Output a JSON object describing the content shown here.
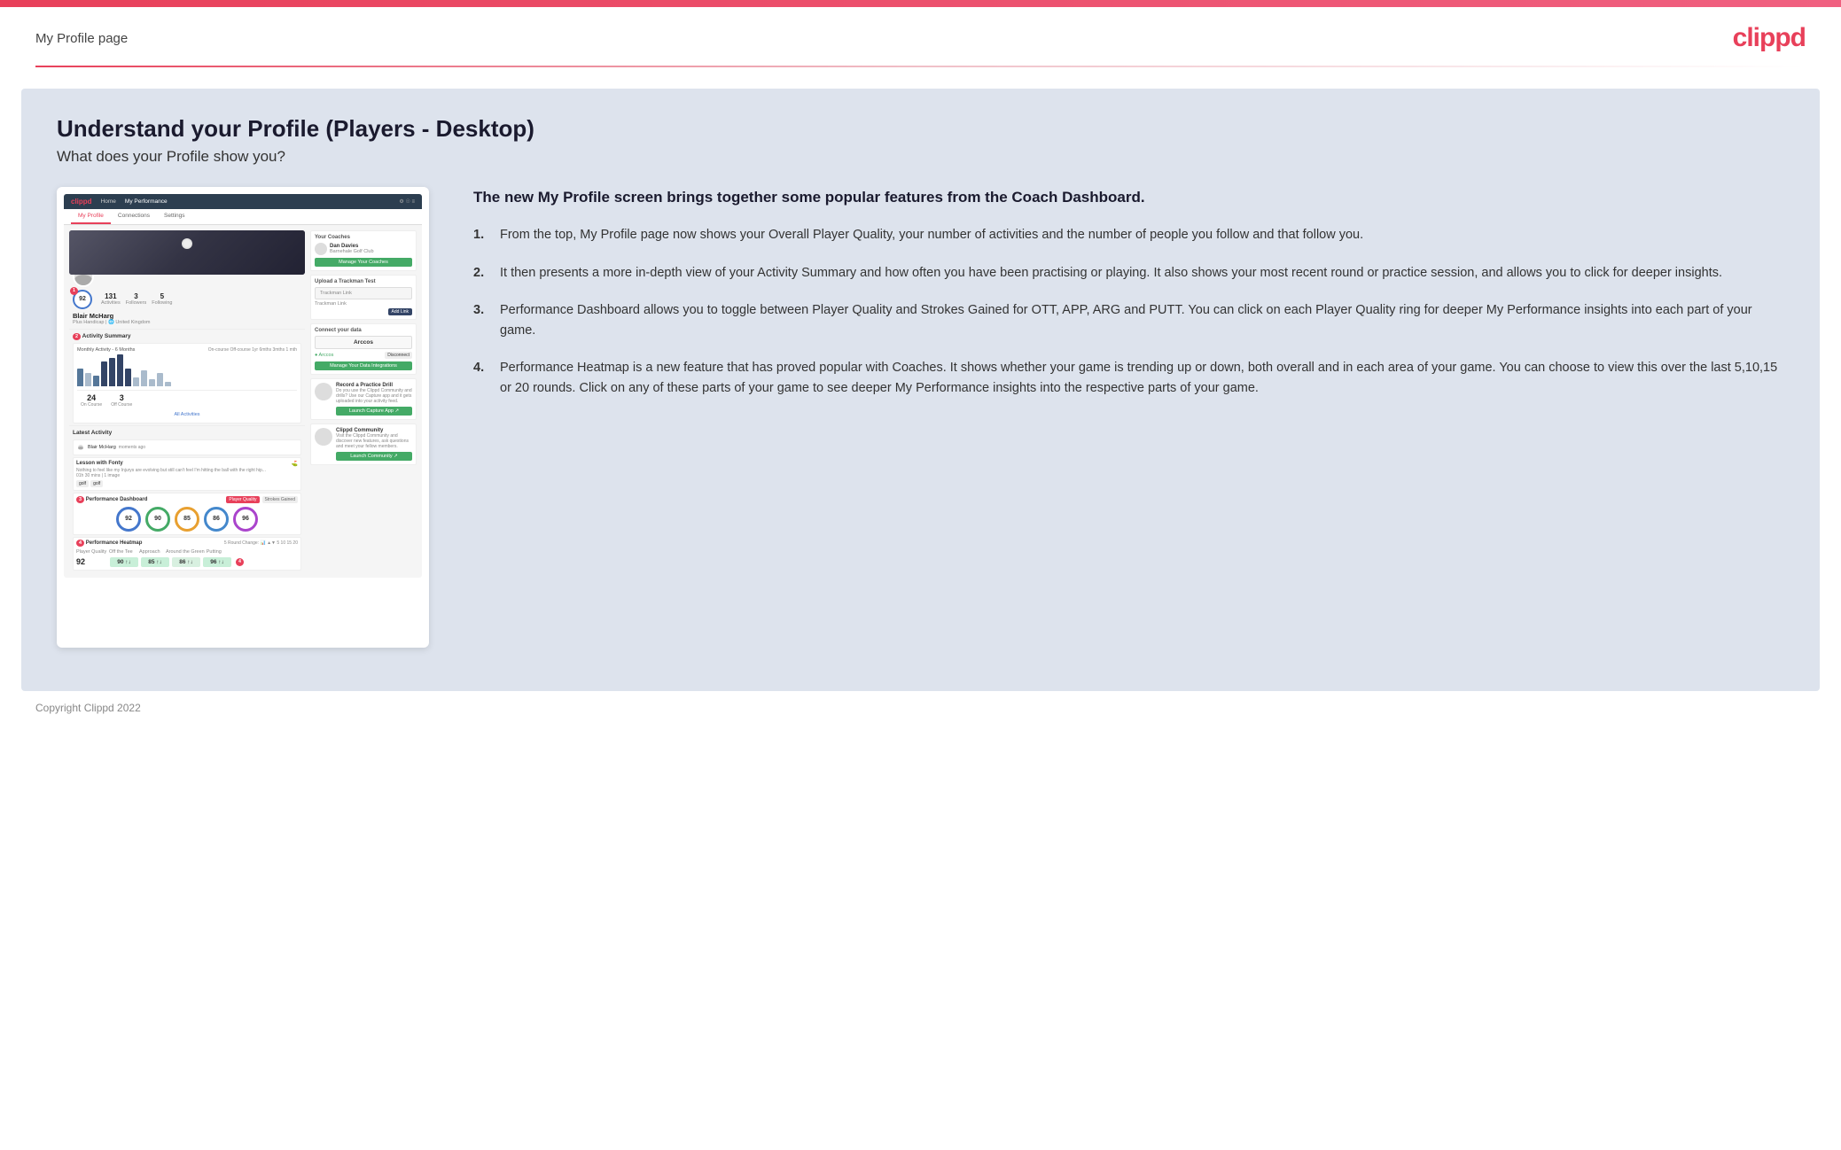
{
  "header": {
    "title": "My Profile page",
    "logo": "clippd"
  },
  "main": {
    "title": "Understand your Profile (Players - Desktop)",
    "subtitle": "What does your Profile show you?",
    "info_intro": "The new My Profile screen brings together some popular features from the Coach Dashboard.",
    "list_items": [
      {
        "id": 1,
        "text": "From the top, My Profile page now shows your Overall Player Quality, your number of activities and the number of people you follow and that follow you."
      },
      {
        "id": 2,
        "text": "It then presents a more in-depth view of your Activity Summary and how often you have been practising or playing. It also shows your most recent round or practice session, and allows you to click for deeper insights."
      },
      {
        "id": 3,
        "text": "Performance Dashboard allows you to toggle between Player Quality and Strokes Gained for OTT, APP, ARG and PUTT. You can click on each Player Quality ring for deeper My Performance insights into each part of your game."
      },
      {
        "id": 4,
        "text": "Performance Heatmap is a new feature that has proved popular with Coaches. It shows whether your game is trending up or down, both overall and in each area of your game. You can choose to view this over the last 5,10,15 or 20 rounds. Click on any of these parts of your game to see deeper My Performance insights into the respective parts of your game."
      }
    ],
    "mock": {
      "player_name": "Blair McHarg",
      "player_quality": "92",
      "activities": "131",
      "followers": "3",
      "following": "5",
      "on_course": "24",
      "off_course": "3",
      "perf_circles": [
        "92",
        "90",
        "85",
        "86",
        "96"
      ],
      "heatmap_values": [
        "92",
        "90 ↑↓",
        "85 ↑↓",
        "86 ↑↓",
        "96 ↑↓"
      ]
    }
  },
  "footer": {
    "copyright": "Copyright Clippd 2022"
  }
}
